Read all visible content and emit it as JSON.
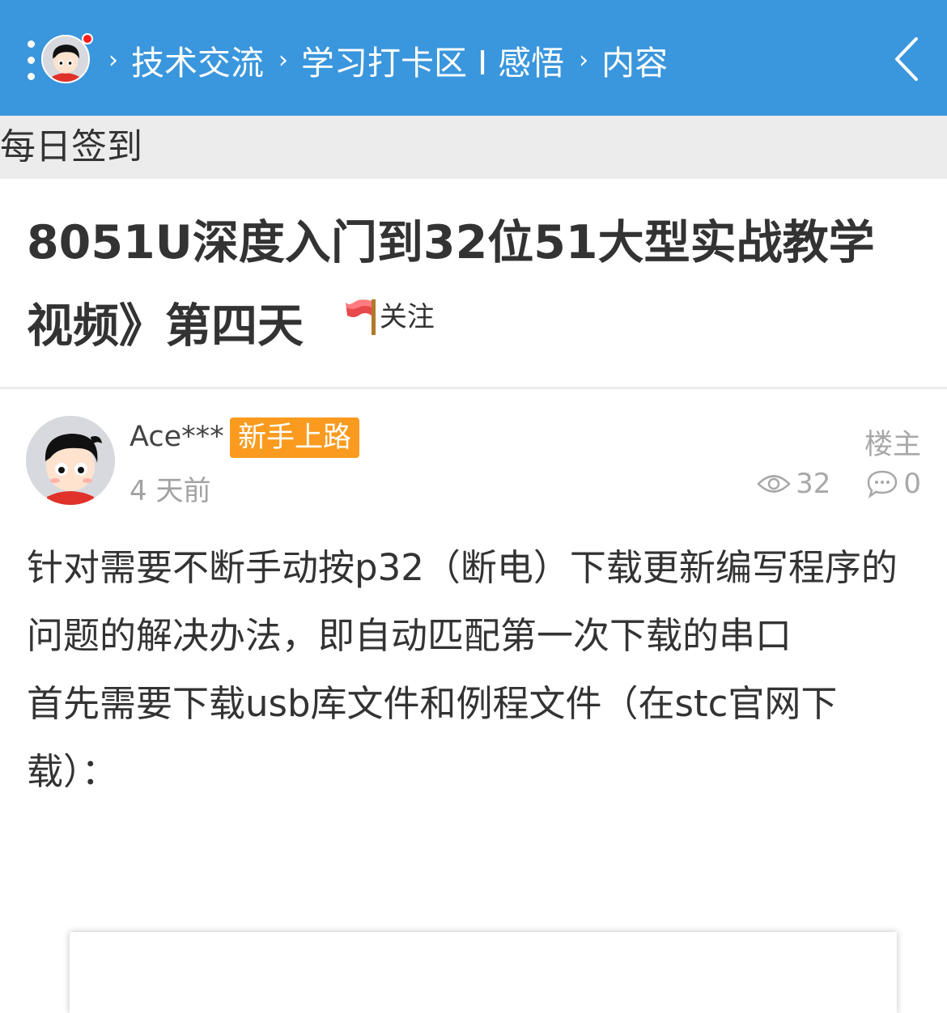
{
  "header": {
    "breadcrumbs": [
      "技术交流",
      "学习打卡区 I 感悟",
      "内容"
    ],
    "icons": {
      "menu": "more-vertical-icon",
      "avatar": "user-avatar",
      "notify": "red-dot-badge",
      "back": "chevron-left-icon"
    },
    "background_color": "#3a96dd"
  },
  "section": {
    "title": "每日签到"
  },
  "post": {
    "title": "8051U深度入门到32位51大型实战教学视频》第四天",
    "follow_label": "关注",
    "author": {
      "name": "Ace***",
      "badge": "新手上路",
      "time": "4 天前",
      "floor": "楼主"
    },
    "stats": {
      "views": "32",
      "comments": "0"
    },
    "content": [
      "针对需要不断手动按p32（断电）下载更新编写程序的问题的解决办法，即自动匹配第一次下载的串口",
      "首先需要下载usb库文件和例程文件（在stc官网下载）："
    ]
  },
  "colors": {
    "badge": "#fa9b1f",
    "header": "#3a96dd",
    "subbar": "#ececec"
  }
}
